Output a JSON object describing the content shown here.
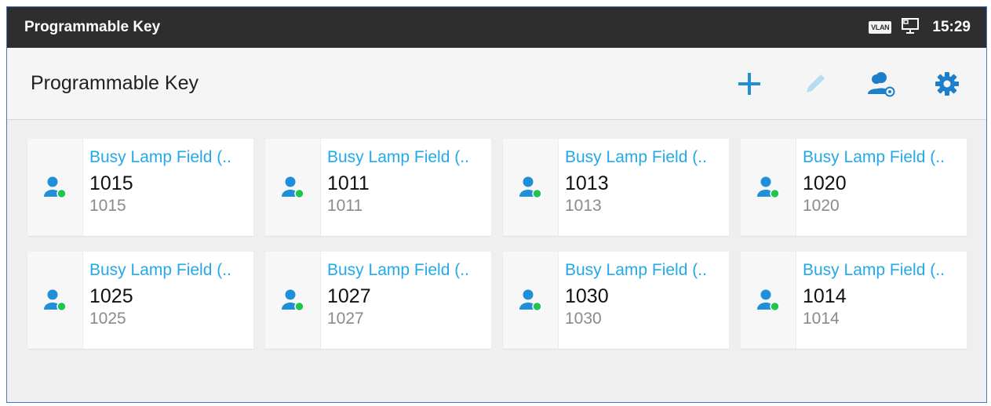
{
  "status_bar": {
    "title": "Programmable Key",
    "vlan_label": "VLAN",
    "network_icon": "ethernet-icon",
    "time": "15:29"
  },
  "header": {
    "title": "Programmable Key",
    "actions": [
      {
        "name": "add-icon",
        "enabled": true
      },
      {
        "name": "edit-icon",
        "enabled": false
      },
      {
        "name": "contacts-monitor-icon",
        "enabled": true
      },
      {
        "name": "settings-icon",
        "enabled": true
      }
    ]
  },
  "colors": {
    "accent": "#22a9ea",
    "status_online": "#1ec650",
    "status_bar_bg": "#2e2e2e",
    "edit_disabled": "#b8dcef"
  },
  "keys": [
    {
      "type": "Busy Lamp Field (..",
      "name": "1015",
      "number": "1015"
    },
    {
      "type": "Busy Lamp Field (..",
      "name": "1011",
      "number": "1011"
    },
    {
      "type": "Busy Lamp Field (..",
      "name": "1013",
      "number": "1013"
    },
    {
      "type": "Busy Lamp Field (..",
      "name": "1020",
      "number": "1020"
    },
    {
      "type": "Busy Lamp Field (..",
      "name": "1025",
      "number": "1025"
    },
    {
      "type": "Busy Lamp Field (..",
      "name": "1027",
      "number": "1027"
    },
    {
      "type": "Busy Lamp Field (..",
      "name": "1030",
      "number": "1030"
    },
    {
      "type": "Busy Lamp Field (..",
      "name": "1014",
      "number": "1014"
    }
  ]
}
